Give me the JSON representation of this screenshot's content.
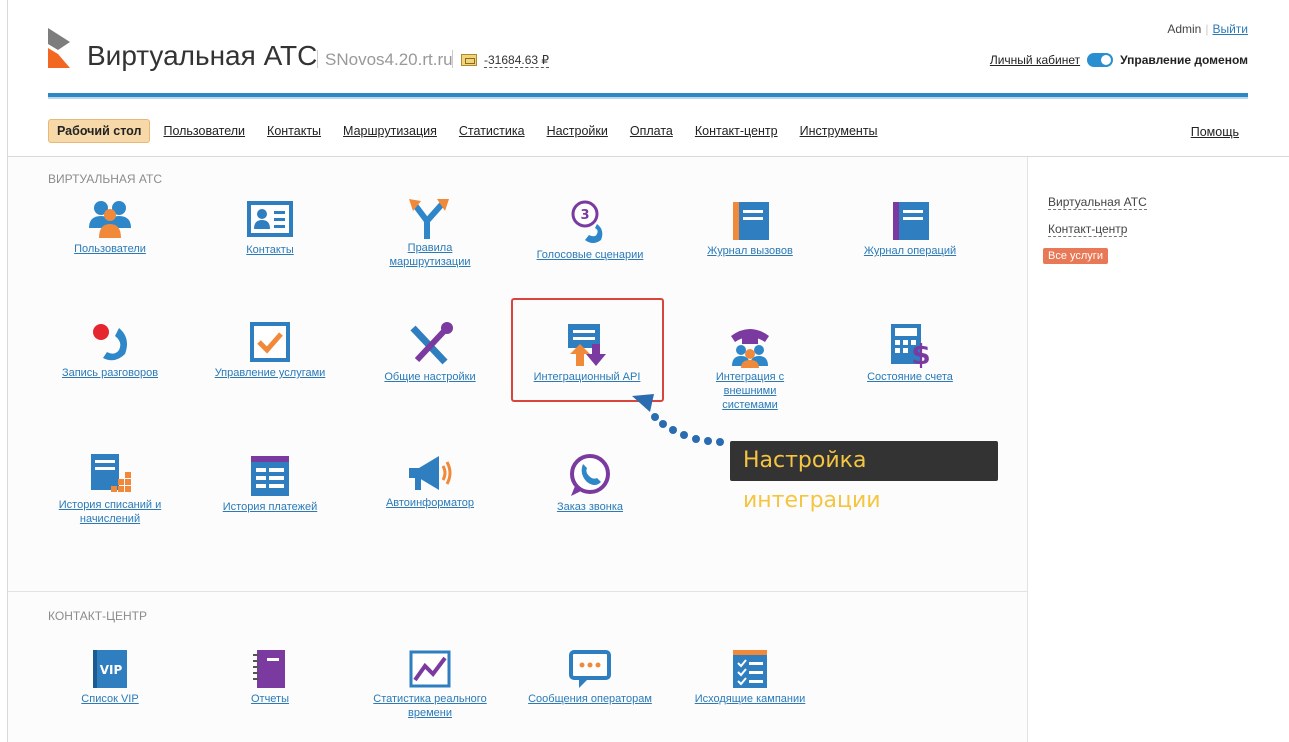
{
  "header": {
    "app_title": "Виртуальная АТС",
    "host": "SNovos4.20.rt.ru",
    "balance": "-31684.63 ₽",
    "user": "Admin",
    "logout": "Выйти",
    "personal_cabinet": "Личный кабинет",
    "domain_management": "Управление доменом"
  },
  "nav": {
    "items": [
      "Рабочий стол",
      "Пользователи",
      "Контакты",
      "Маршрутизация",
      "Статистика",
      "Настройки",
      "Оплата",
      "Контакт-центр",
      "Инструменты"
    ],
    "help": "Помощь"
  },
  "sections": {
    "vats": {
      "title": "Виртуальная АТС",
      "tiles": [
        {
          "label": "Пользователи",
          "icon": "users-icon"
        },
        {
          "label": "Контакты",
          "icon": "contacts-icon"
        },
        {
          "label": "Правила маршрутизации",
          "icon": "routing-icon"
        },
        {
          "label": "Голосовые сценарии",
          "icon": "voice-scenario-icon"
        },
        {
          "label": "Журнал вызовов",
          "icon": "call-log-icon"
        },
        {
          "label": "Журнал операций",
          "icon": "operations-log-icon"
        },
        {
          "label": "Запись разговоров",
          "icon": "call-recording-icon"
        },
        {
          "label": "Управление услугами",
          "icon": "services-icon"
        },
        {
          "label": "Общие настройки",
          "icon": "tools-icon"
        },
        {
          "label": "Интеграционный API",
          "icon": "api-icon"
        },
        {
          "label": "Интеграция с внешними системами",
          "icon": "external-integration-icon"
        },
        {
          "label": "Состояние счета",
          "icon": "account-state-icon"
        },
        {
          "label": "История списаний и начислений",
          "icon": "charges-history-icon"
        },
        {
          "label": "История платежей",
          "icon": "payments-history-icon"
        },
        {
          "label": "Автоинформатор",
          "icon": "megaphone-icon"
        },
        {
          "label": "Заказ звонка",
          "icon": "callback-icon"
        }
      ]
    },
    "contact_center": {
      "title": "Контакт-центр",
      "tiles": [
        {
          "label": "Список VIP",
          "icon": "vip-list-icon"
        },
        {
          "label": "Отчеты",
          "icon": "reports-icon"
        },
        {
          "label": "Статистика реального времени",
          "icon": "realtime-stats-icon"
        },
        {
          "label": "Сообщения операторам",
          "icon": "operator-messages-icon"
        },
        {
          "label": "Исходящие кампании",
          "icon": "outgoing-campaigns-icon"
        }
      ]
    }
  },
  "callout": {
    "text": "Настройка интеграции"
  },
  "sidebar": {
    "items": [
      "Виртуальная АТС",
      "Контакт-центр"
    ],
    "badge": "Все услуги"
  },
  "colors": {
    "accent": "#2b88c5",
    "highlight": "#d9453c",
    "callout_text": "#f5c542",
    "badge": "#e87856"
  },
  "vip_text": "VIP",
  "voice_number": "3"
}
